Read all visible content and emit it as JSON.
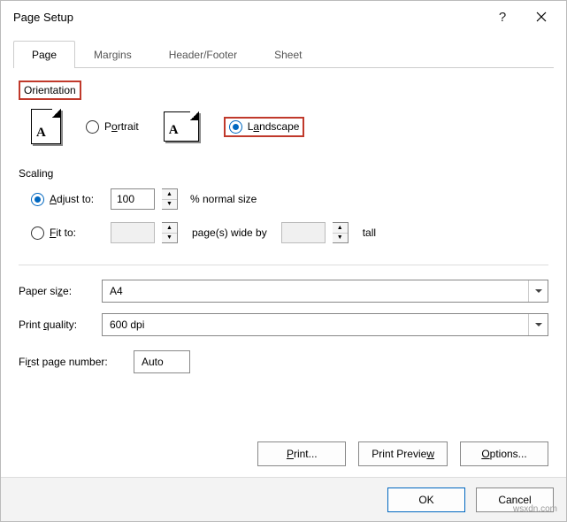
{
  "title": "Page Setup",
  "tabs": {
    "page": "Page",
    "margins": "Margins",
    "headerfooter": "Header/Footer",
    "sheet": "Sheet"
  },
  "orientation": {
    "label": "Orientation",
    "portrait": "Portrait",
    "landscape": "Landscape",
    "selected": "landscape"
  },
  "scaling": {
    "label": "Scaling",
    "adjust_label": "Adjust to:",
    "adjust_value": "100",
    "adjust_suffix": "% normal size",
    "fit_label": "Fit to:",
    "fit_wide": "",
    "fit_mid": "page(s) wide by",
    "fit_tall": "",
    "fit_suffix": "tall",
    "selected": "adjust"
  },
  "paper_size": {
    "label": "Paper size:",
    "value": "A4"
  },
  "print_quality": {
    "label": "Print quality:",
    "value": "600 dpi"
  },
  "first_page": {
    "label": "First page number:",
    "value": "Auto"
  },
  "buttons": {
    "print": "Print...",
    "preview": "Print Preview",
    "options": "Options...",
    "ok": "OK",
    "cancel": "Cancel"
  },
  "watermark": "wsxdn.com"
}
